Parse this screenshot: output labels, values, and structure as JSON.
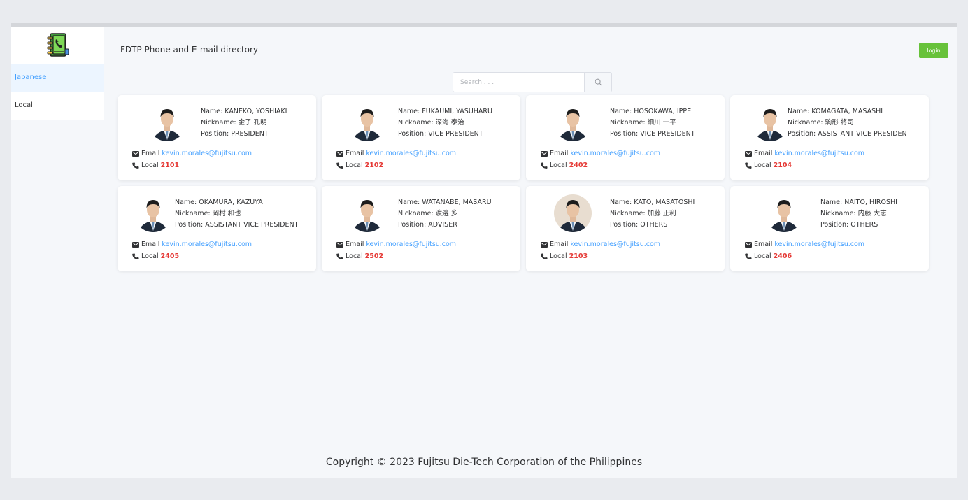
{
  "header": {
    "title": "FDTP Phone and E-mail directory",
    "login_label": "login"
  },
  "sidebar": {
    "items": [
      {
        "label": "Japanese",
        "active": true
      },
      {
        "label": "Local",
        "active": false
      }
    ]
  },
  "search": {
    "placeholder": "Search . . ."
  },
  "labels": {
    "name": "Name: ",
    "nickname": "Nickname: ",
    "position": "Position: ",
    "email": "Email",
    "local": "Local"
  },
  "employees": [
    {
      "name": "KANEKO, YOSHIAKI",
      "nickname": "金子 孔明",
      "position": "PRESIDENT",
      "email": "kevin.morales@fujitsu.com",
      "local": "2101",
      "photo_bg": "#ffffff"
    },
    {
      "name": "FUKAUMI, YASUHARU",
      "nickname": "深海 泰治",
      "position": "VICE PRESIDENT",
      "email": "kevin.morales@fujitsu.com",
      "local": "2102",
      "photo_bg": "#ffffff"
    },
    {
      "name": "HOSOKAWA, IPPEI",
      "nickname": "細川 一平",
      "position": "VICE PRESIDENT",
      "email": "kevin.morales@fujitsu.com",
      "local": "2402",
      "photo_bg": "#ffffff"
    },
    {
      "name": "KOMAGATA, MASASHI",
      "nickname": "駒形 将司",
      "position": "ASSISTANT VICE PRESIDENT",
      "email": "kevin.morales@fujitsu.com",
      "local": "2104",
      "photo_bg": "#ffffff"
    },
    {
      "name": "OKAMURA, KAZUYA",
      "nickname": "岡村 和也",
      "position": "ASSISTANT VICE PRESIDENT",
      "email": "kevin.morales@fujitsu.com",
      "local": "2405",
      "photo_bg": "#ffffff"
    },
    {
      "name": "WATANABE, MASARU",
      "nickname": "渡邉 多",
      "position": "ADVISER",
      "email": "kevin.morales@fujitsu.com",
      "local": "2502",
      "photo_bg": "#ffffff"
    },
    {
      "name": "KATO, MASATOSHI",
      "nickname": "加藤 正利",
      "position": "OTHERS",
      "email": "kevin.morales@fujitsu.com",
      "local": "2103",
      "photo_bg": "#e8ddd0"
    },
    {
      "name": "NAITO, HIROSHI",
      "nickname": "内藤 大志",
      "position": "OTHERS",
      "email": "kevin.morales@fujitsu.com",
      "local": "2406",
      "photo_bg": "#ffffff"
    }
  ],
  "footer": {
    "copyright": "Copyright © 2023 Fujitsu Die-Tech Corporation of the Philippines"
  },
  "colors": {
    "accent": "#409eff",
    "login": "#67c23a",
    "local_number": "#e53935"
  },
  "icons": {
    "logo": "phonebook-icon",
    "search": "search-icon",
    "email": "envelope-icon",
    "phone": "phone-icon"
  }
}
